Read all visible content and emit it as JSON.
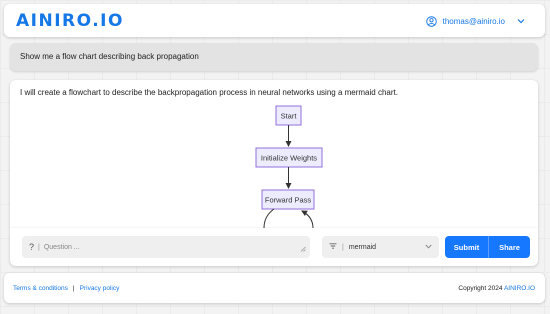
{
  "header": {
    "logo": "AINIRO.IO",
    "user_email": "thomas@ainiro.io"
  },
  "prompt": {
    "text": "Show me a flow chart describing back propagation"
  },
  "answer": {
    "text": "I will create a flowchart to describe the backpropagation process in neural networks using a mermaid chart.",
    "flow": {
      "nodes": [
        "Start",
        "Initialize Weights",
        "Forward Pass"
      ]
    }
  },
  "input": {
    "question_icon": "?",
    "separator": "|",
    "question_placeholder": "Question ...",
    "mode_value": "mermaid",
    "submit_label": "Submit",
    "share_label": "Share"
  },
  "footer": {
    "terms_label": "Terms & conditions",
    "separator": "|",
    "privacy_label": "Privacy policy",
    "copyright": "Copyright 2024",
    "brand_link": "AINIRO.IO"
  },
  "colors": {
    "accent": "#1677ff",
    "node_fill": "#ececfe",
    "node_stroke": "#9370db"
  }
}
